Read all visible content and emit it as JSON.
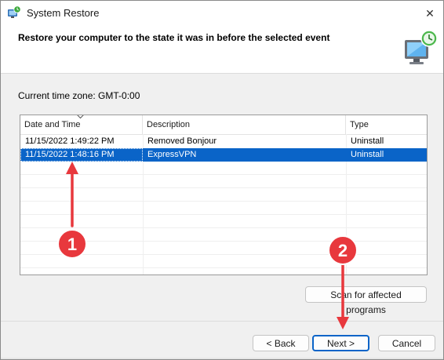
{
  "window": {
    "title": "System Restore",
    "close_glyph": "✕"
  },
  "header": {
    "title": "Restore your computer to the state it was in before the selected event",
    "icon": "system-restore-monitor-icon"
  },
  "timezone": {
    "label": "Current time zone: GMT-0:00"
  },
  "list": {
    "columns": [
      "Date and Time",
      "Description",
      "Type"
    ],
    "sort_icon": "sort-descending-icon",
    "rows": [
      {
        "date": "11/15/2022 1:49:22 PM",
        "description": "Removed Bonjour",
        "type": "Uninstall",
        "selected": false
      },
      {
        "date": "11/15/2022 1:48:16 PM",
        "description": "ExpressVPN",
        "type": "Uninstall",
        "selected": true
      }
    ]
  },
  "buttons": {
    "scan": "Scan for affected programs",
    "back": "< Back",
    "next": "Next >",
    "cancel": "Cancel"
  },
  "annotations": {
    "marker_1": "1",
    "marker_2": "2",
    "color": "#e8383d"
  },
  "colors": {
    "selection": "#0a64c8",
    "primary_border": "#0a64c8"
  }
}
